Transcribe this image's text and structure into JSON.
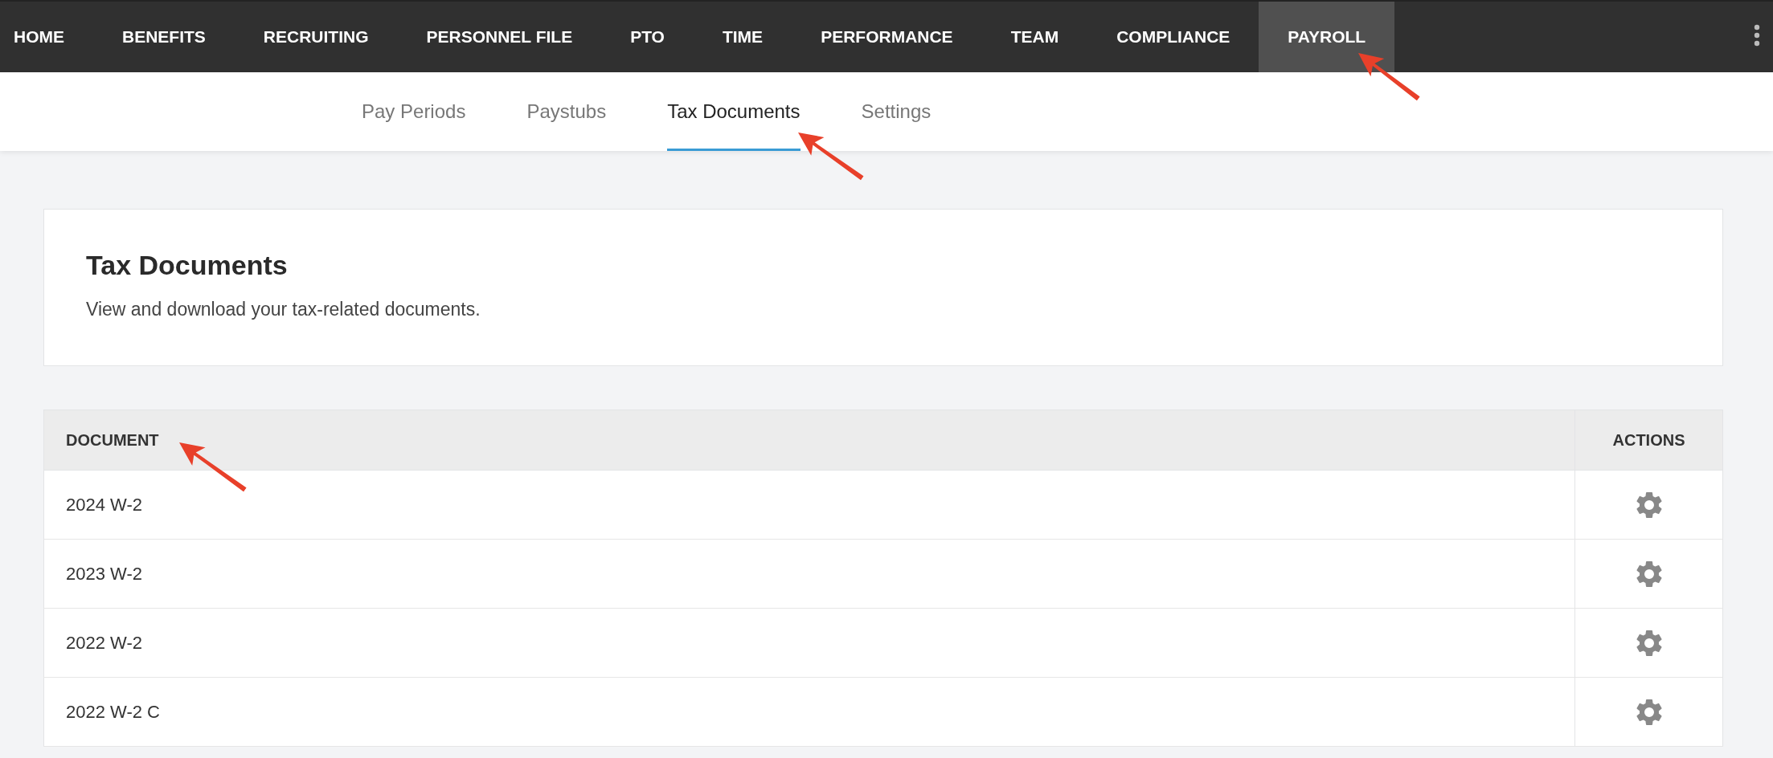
{
  "nav": [
    {
      "label": "HOME",
      "selected": false
    },
    {
      "label": "BENEFITS",
      "selected": false
    },
    {
      "label": "RECRUITING",
      "selected": false
    },
    {
      "label": "PERSONNEL FILE",
      "selected": false
    },
    {
      "label": "PTO",
      "selected": false
    },
    {
      "label": "TIME",
      "selected": false
    },
    {
      "label": "PERFORMANCE",
      "selected": false
    },
    {
      "label": "TEAM",
      "selected": false
    },
    {
      "label": "COMPLIANCE",
      "selected": false
    },
    {
      "label": "PAYROLL",
      "selected": true
    }
  ],
  "tabs": [
    {
      "label": "Pay Periods",
      "selected": false
    },
    {
      "label": "Paystubs",
      "selected": false
    },
    {
      "label": "Tax Documents",
      "selected": true
    },
    {
      "label": "Settings",
      "selected": false
    }
  ],
  "header_card": {
    "title": "Tax Documents",
    "subtitle": "View and download your tax-related documents."
  },
  "table": {
    "columns": [
      "DOCUMENT",
      "ACTIONS"
    ],
    "rows": [
      {
        "document": "2024 W-2"
      },
      {
        "document": "2023 W-2"
      },
      {
        "document": "2022 W-2"
      },
      {
        "document": "2022 W-2 C"
      }
    ]
  }
}
